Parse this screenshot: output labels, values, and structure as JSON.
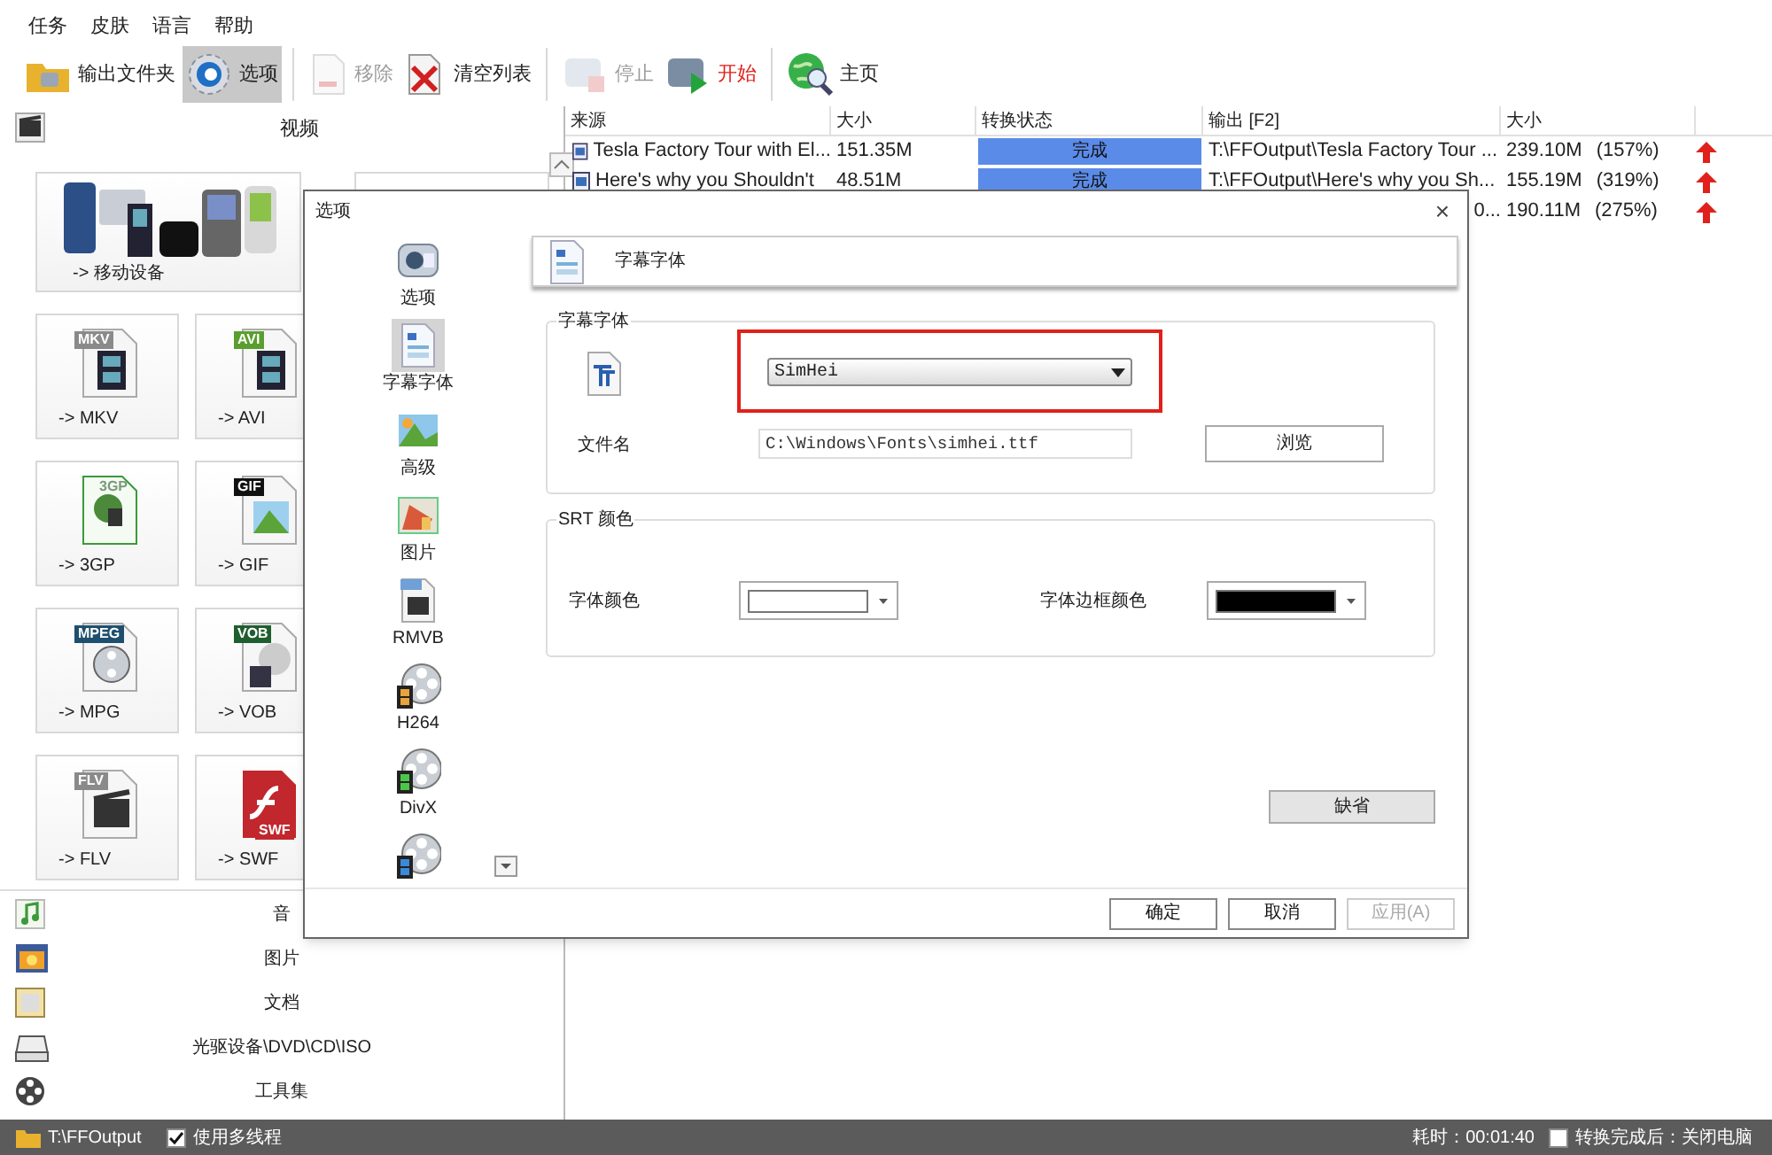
{
  "menu": [
    "任务",
    "皮肤",
    "语言",
    "帮助"
  ],
  "toolbar": [
    {
      "label": "输出文件夹",
      "selected": false,
      "disabled": false,
      "highlighted": false
    },
    {
      "label": "选项",
      "selected": true,
      "disabled": false,
      "highlighted": false
    },
    {
      "label": "移除",
      "selected": false,
      "disabled": true,
      "highlighted": false
    },
    {
      "label": "清空列表",
      "selected": false,
      "disabled": false,
      "highlighted": false
    },
    {
      "label": "停止",
      "selected": false,
      "disabled": true,
      "highlighted": false
    },
    {
      "label": "开始",
      "selected": false,
      "disabled": false,
      "highlighted": true
    },
    {
      "label": "主页",
      "selected": false,
      "disabled": false,
      "highlighted": false
    }
  ],
  "left_panel": {
    "header": "视频",
    "large_tiles": [
      {
        "label": "-> 移动设备"
      }
    ],
    "tiles": [
      {
        "label": "-> MKV",
        "badge": "MKV"
      },
      {
        "label": "-> AVI",
        "badge": "AVI"
      },
      {
        "label": "-> 3GP",
        "badge": "3GP"
      },
      {
        "label": "-> GIF",
        "badge": "GIF"
      },
      {
        "label": "-> MPG",
        "badge": "MPEG"
      },
      {
        "label": "-> VOB",
        "badge": "VOB"
      },
      {
        "label": "-> FLV",
        "badge": "FLV"
      },
      {
        "label": "-> SWF",
        "badge": "SWF"
      }
    ],
    "categories": [
      {
        "label": "音"
      },
      {
        "label": "图片"
      },
      {
        "label": "文档"
      },
      {
        "label": "光驱设备\\DVD\\CD\\ISO"
      },
      {
        "label": "工具集"
      }
    ]
  },
  "table": {
    "columns": [
      "来源",
      "大小",
      "转换状态",
      "输出 [F2]",
      "大小"
    ],
    "rows": [
      {
        "source": "Tesla Factory Tour with El...",
        "size": "151.35M",
        "status": "完成",
        "output": "T:\\FFOutput\\Tesla Factory Tour ...",
        "out_size": "239.10M",
        "ratio": "(157%)"
      },
      {
        "source": "Here's why you Shouldn't",
        "size": "48.51M",
        "status": "完成",
        "output": "T:\\FFOutput\\Here's why you Sh...",
        "out_size": "155.19M",
        "ratio": "(319%)"
      },
      {
        "output": "0...",
        "out_size": "190.11M",
        "ratio": "(275%)"
      }
    ]
  },
  "dialog": {
    "title": "选项",
    "close": "×",
    "nav": [
      {
        "label": "选项",
        "selected": false
      },
      {
        "label": "字幕字体",
        "selected": true
      },
      {
        "label": "高级",
        "selected": false
      },
      {
        "label": "图片",
        "selected": false
      },
      {
        "label": "RMVB",
        "selected": false
      },
      {
        "label": "H264",
        "selected": false
      },
      {
        "label": "DivX",
        "selected": false
      },
      {
        "selected": false
      }
    ],
    "page_title": "字幕字体",
    "font_group": {
      "title": "字幕字体",
      "font": "SimHei",
      "file_label": "文件名",
      "file": "C:\\Windows\\Fonts\\simhei.ttf",
      "browse": "浏览",
      "highlighted": true
    },
    "srt_group": {
      "title": "SRT 颜色",
      "fields": [
        {
          "label": "字体颜色",
          "color": "#ffffff"
        },
        {
          "label": "字体边框颜色",
          "color": "#000000"
        }
      ]
    },
    "default_button": "缺省",
    "buttons": [
      {
        "label": "确定",
        "disabled": false
      },
      {
        "label": "取消",
        "disabled": false
      },
      {
        "label": "应用(A)",
        "disabled": true
      }
    ]
  },
  "status_bar": {
    "path": "T:\\FFOutput",
    "multithread": {
      "label": "使用多线程",
      "checked": true
    },
    "elapsed": "耗时：00:01:40",
    "shutdown": {
      "label": "转换完成后：关闭电脑",
      "checked": false
    }
  }
}
